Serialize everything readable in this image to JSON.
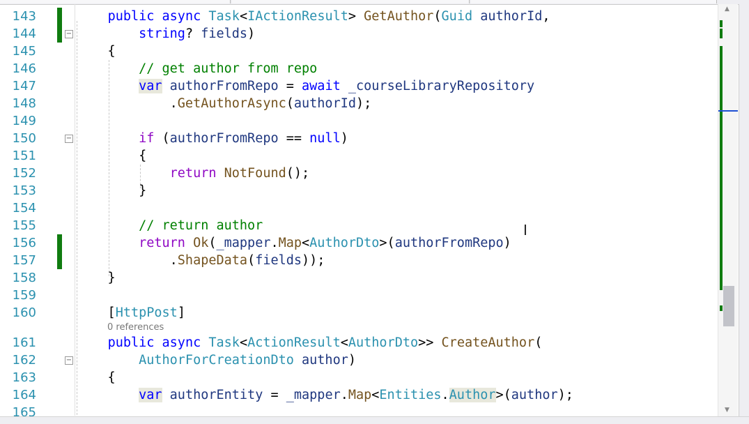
{
  "editor": {
    "lines": [
      {
        "n": "143",
        "change": true,
        "tokens": [
          [
            "    ",
            "pl"
          ],
          [
            "public",
            "kw"
          ],
          [
            " ",
            "pl"
          ],
          [
            "async",
            "kw"
          ],
          [
            " ",
            "pl"
          ],
          [
            "Task",
            "ty"
          ],
          [
            "<",
            "pl"
          ],
          [
            "IActionResult",
            "ty"
          ],
          [
            "> ",
            "pl"
          ],
          [
            "GetAuthor",
            "fn"
          ],
          [
            "(",
            "pl"
          ],
          [
            "Guid",
            "ty"
          ],
          [
            " ",
            "pl"
          ],
          [
            "authorId",
            "id"
          ],
          [
            ",",
            "pl"
          ]
        ]
      },
      {
        "n": "144",
        "change": true,
        "fold": true,
        "tokens": [
          [
            "        ",
            "pl"
          ],
          [
            "string",
            "kw"
          ],
          [
            "? ",
            "pl"
          ],
          [
            "fields",
            "id"
          ],
          [
            ")",
            "pl"
          ]
        ]
      },
      {
        "n": "145",
        "tokens": [
          [
            "    {",
            "pl"
          ]
        ]
      },
      {
        "n": "146",
        "tokens": [
          [
            "        ",
            "pl"
          ],
          [
            "// get author from repo",
            "cm"
          ]
        ]
      },
      {
        "n": "147",
        "tokens": [
          [
            "        ",
            "pl"
          ],
          [
            "var",
            "kw hl"
          ],
          [
            " ",
            "pl"
          ],
          [
            "authorFromRepo",
            "id"
          ],
          [
            " = ",
            "pl"
          ],
          [
            "await",
            "kw"
          ],
          [
            " ",
            "pl"
          ],
          [
            "_courseLibraryRepository",
            "id"
          ]
        ]
      },
      {
        "n": "148",
        "tokens": [
          [
            "            .",
            "pl"
          ],
          [
            "GetAuthorAsync",
            "fn"
          ],
          [
            "(",
            "pl"
          ],
          [
            "authorId",
            "id"
          ],
          [
            ");",
            "pl"
          ]
        ]
      },
      {
        "n": "149",
        "tokens": []
      },
      {
        "n": "150",
        "fold": true,
        "tokens": [
          [
            "        ",
            "pl"
          ],
          [
            "if",
            "ctl"
          ],
          [
            " (",
            "pl"
          ],
          [
            "authorFromRepo",
            "id"
          ],
          [
            " == ",
            "pl"
          ],
          [
            "null",
            "kw"
          ],
          [
            ")",
            "pl"
          ]
        ]
      },
      {
        "n": "151",
        "tokens": [
          [
            "        {",
            "pl"
          ]
        ]
      },
      {
        "n": "152",
        "tokens": [
          [
            "            ",
            "pl"
          ],
          [
            "return",
            "ctl"
          ],
          [
            " ",
            "pl"
          ],
          [
            "NotFound",
            "fn"
          ],
          [
            "();",
            "pl"
          ]
        ]
      },
      {
        "n": "153",
        "tokens": [
          [
            "        }",
            "pl"
          ]
        ]
      },
      {
        "n": "154",
        "tokens": []
      },
      {
        "n": "155",
        "tokens": [
          [
            "        ",
            "pl"
          ],
          [
            "// return author",
            "cm"
          ]
        ]
      },
      {
        "n": "156",
        "change": true,
        "tokens": [
          [
            "        ",
            "pl"
          ],
          [
            "return",
            "ctl"
          ],
          [
            " ",
            "pl"
          ],
          [
            "Ok",
            "fn"
          ],
          [
            "(",
            "pl"
          ],
          [
            "_mapper",
            "id"
          ],
          [
            ".",
            "pl"
          ],
          [
            "Map",
            "fn"
          ],
          [
            "<",
            "pl"
          ],
          [
            "AuthorDto",
            "ty"
          ],
          [
            ">(",
            "pl"
          ],
          [
            "authorFromRepo",
            "id"
          ],
          [
            ")",
            "pl"
          ]
        ]
      },
      {
        "n": "157",
        "change": true,
        "tokens": [
          [
            "            .",
            "pl"
          ],
          [
            "ShapeData",
            "fn"
          ],
          [
            "(",
            "pl"
          ],
          [
            "fields",
            "id"
          ],
          [
            "));",
            "pl"
          ]
        ]
      },
      {
        "n": "158",
        "tokens": [
          [
            "    }",
            "pl"
          ]
        ]
      },
      {
        "n": "159",
        "tokens": []
      },
      {
        "n": "160",
        "tokens": [
          [
            "    [",
            "pl"
          ],
          [
            "HttpPost",
            "ty"
          ],
          [
            "]",
            "pl"
          ]
        ]
      },
      {
        "lens": "0 references"
      },
      {
        "n": "161",
        "tokens": [
          [
            "    ",
            "pl"
          ],
          [
            "public",
            "kw"
          ],
          [
            " ",
            "pl"
          ],
          [
            "async",
            "kw"
          ],
          [
            " ",
            "pl"
          ],
          [
            "Task",
            "ty"
          ],
          [
            "<",
            "pl"
          ],
          [
            "ActionResult",
            "ty"
          ],
          [
            "<",
            "pl"
          ],
          [
            "AuthorDto",
            "ty"
          ],
          [
            ">> ",
            "pl"
          ],
          [
            "CreateAuthor",
            "fn"
          ],
          [
            "(",
            "pl"
          ]
        ]
      },
      {
        "n": "162",
        "fold": true,
        "tokens": [
          [
            "        ",
            "pl"
          ],
          [
            "AuthorForCreationDto",
            "ty"
          ],
          [
            " ",
            "pl"
          ],
          [
            "author",
            "id"
          ],
          [
            ")",
            "pl"
          ]
        ]
      },
      {
        "n": "163",
        "tokens": [
          [
            "    {",
            "pl"
          ]
        ]
      },
      {
        "n": "164",
        "tokens": [
          [
            "        ",
            "pl"
          ],
          [
            "var",
            "kw hl"
          ],
          [
            " ",
            "pl"
          ],
          [
            "authorEntity",
            "id"
          ],
          [
            " = ",
            "pl"
          ],
          [
            "_mapper",
            "id"
          ],
          [
            ".",
            "pl"
          ],
          [
            "Map",
            "fn"
          ],
          [
            "<",
            "pl"
          ],
          [
            "Entities",
            "ty"
          ],
          [
            ".",
            "pl"
          ],
          [
            "Author",
            "ty hl"
          ],
          [
            ">(",
            "pl"
          ],
          [
            "author",
            "id"
          ],
          [
            ");",
            "pl"
          ]
        ]
      },
      {
        "n": "165",
        "tokens": []
      }
    ]
  },
  "colors": {
    "keyword": "#0000ff",
    "type": "#2b91af",
    "method": "#74531f",
    "identifier": "#1f377f",
    "comment": "#008000",
    "control": "#8f08c4",
    "change_bar": "#107c10"
  },
  "icons": {
    "fold": "collapse-box-icon",
    "cursor": "text-cursor-icon"
  },
  "fold_glyph": "−",
  "scroll_up": "▲",
  "scroll_down": "▼",
  "cursor_glyph": "I"
}
